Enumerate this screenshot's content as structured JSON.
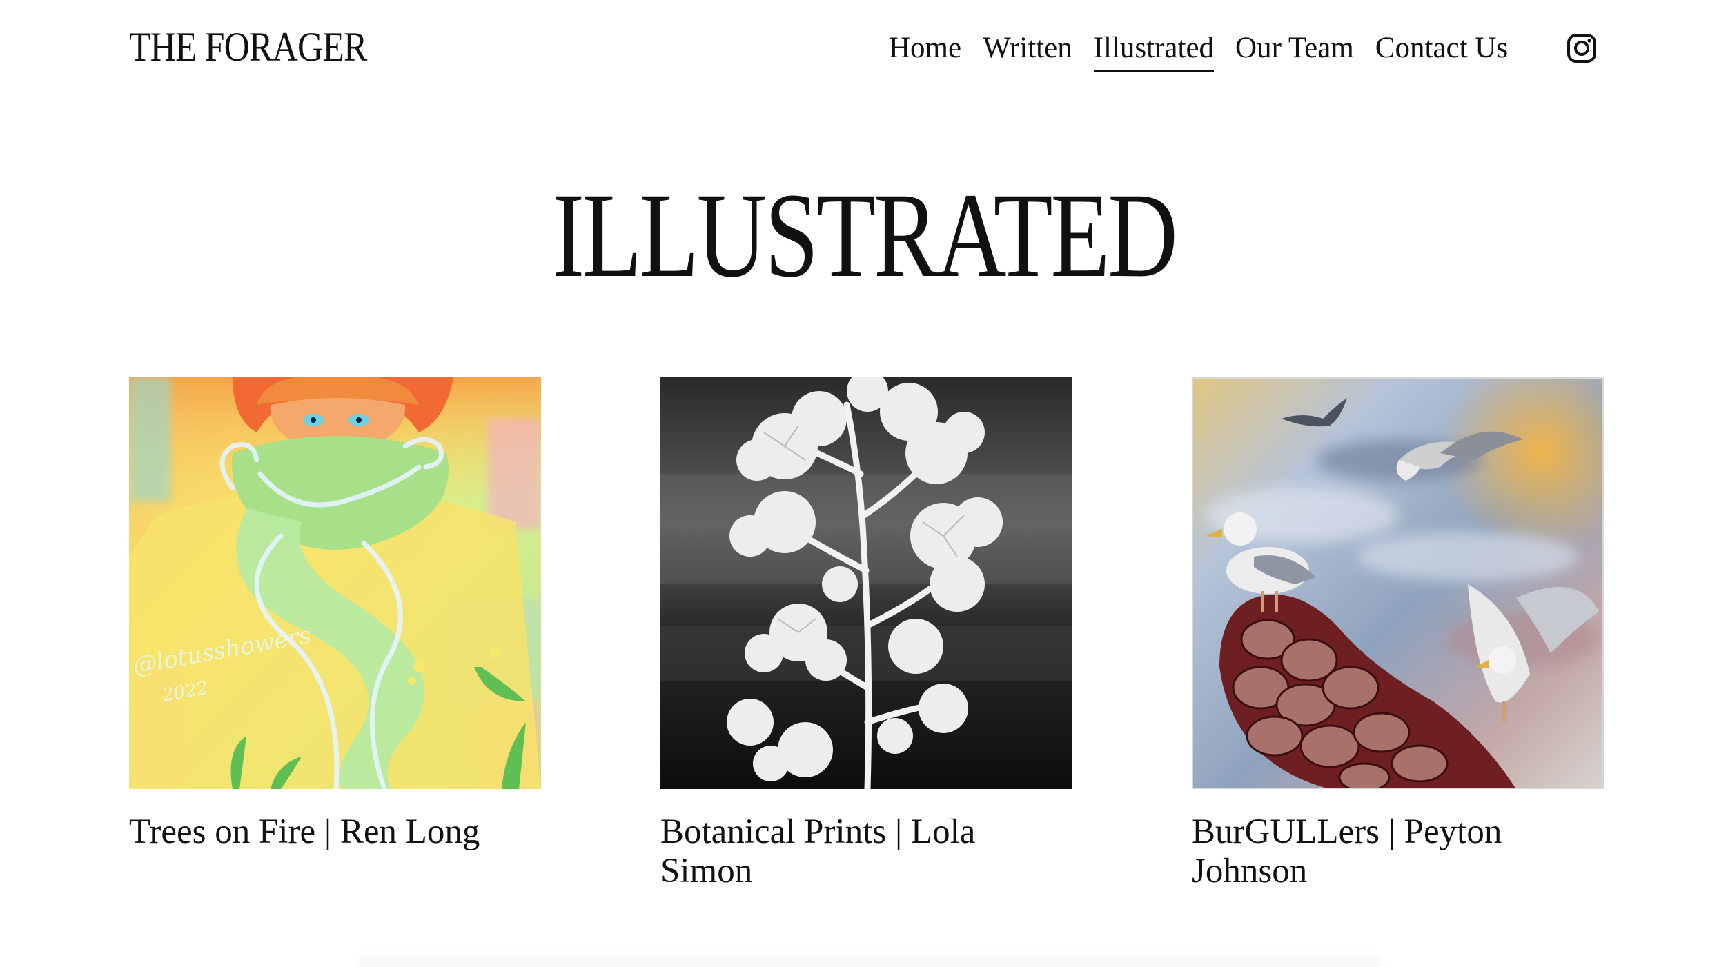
{
  "site": {
    "title": "THE FORAGER"
  },
  "nav": {
    "items": [
      {
        "label": "Home",
        "active": false
      },
      {
        "label": "Written",
        "active": false
      },
      {
        "label": "Illustrated",
        "active": true
      },
      {
        "label": "Our Team",
        "active": false
      },
      {
        "label": "Contact Us",
        "active": false
      }
    ],
    "social_icon": "instagram-icon"
  },
  "page": {
    "title": "ILLUSTRATED"
  },
  "gallery": {
    "items": [
      {
        "caption": "Trees on Fire | Ren Long",
        "artwork_text": "@lotusshowers 2022",
        "palette": [
          "#f6b457",
          "#c8ec8d",
          "#f7e26c",
          "#f46a3a",
          "#a9d8ef"
        ]
      },
      {
        "caption": "Botanical Prints | Lola Simon",
        "palette": [
          "#111111",
          "#6b6b6b",
          "#f2f2f2"
        ]
      },
      {
        "caption": "BurGULLers | Peyton Johnson",
        "palette": [
          "#b9c6d8",
          "#dfb063",
          "#7a2a25",
          "#e8e8e6",
          "#4b4f58"
        ]
      }
    ]
  }
}
